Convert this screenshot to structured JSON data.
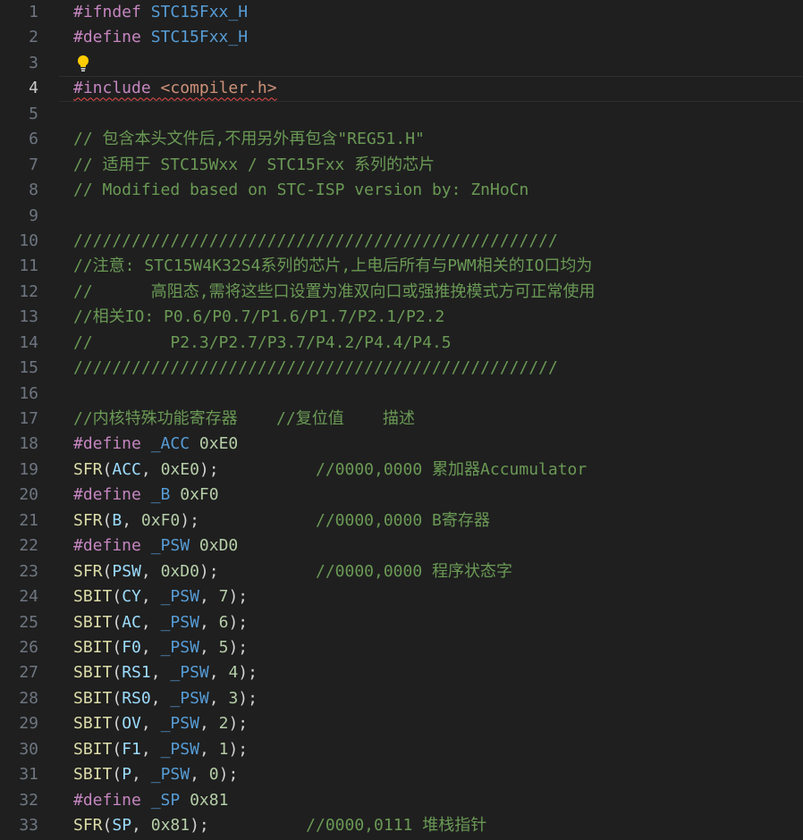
{
  "editor": {
    "lines": [
      {
        "n": "1",
        "tokens": [
          [
            "kw",
            "#ifndef "
          ],
          [
            "mac",
            "STC15Fxx_H"
          ]
        ]
      },
      {
        "n": "2",
        "tokens": [
          [
            "kw",
            "#define "
          ],
          [
            "mac",
            "STC15Fxx_H"
          ]
        ]
      },
      {
        "n": "3",
        "tokens": [],
        "lightbulb": true
      },
      {
        "n": "4",
        "current": true,
        "squiggle": true,
        "tokens": [
          [
            "kw",
            "#include "
          ],
          [
            "str",
            "<compiler.h>"
          ]
        ]
      },
      {
        "n": "5",
        "tokens": []
      },
      {
        "n": "6",
        "tokens": [
          [
            "com",
            "// 包含本头文件后,不用另外再包含\"REG51.H\""
          ]
        ]
      },
      {
        "n": "7",
        "tokens": [
          [
            "com",
            "// 适用于 STC15Wxx / STC15Fxx 系列的芯片"
          ]
        ]
      },
      {
        "n": "8",
        "tokens": [
          [
            "com",
            "// Modified based on STC-ISP version by: ZnHoCn"
          ]
        ]
      },
      {
        "n": "9",
        "tokens": []
      },
      {
        "n": "10",
        "tokens": [
          [
            "com",
            "//////////////////////////////////////////////////"
          ]
        ]
      },
      {
        "n": "11",
        "tokens": [
          [
            "com",
            "//注意: STC15W4K32S4系列的芯片,上电后所有与PWM相关的IO口均为"
          ]
        ]
      },
      {
        "n": "12",
        "tokens": [
          [
            "com",
            "//      高阻态,需将这些口设置为准双向口或强推挽模式方可正常使用"
          ]
        ]
      },
      {
        "n": "13",
        "tokens": [
          [
            "com",
            "//相关IO: P0.6/P0.7/P1.6/P1.7/P2.1/P2.2"
          ]
        ]
      },
      {
        "n": "14",
        "tokens": [
          [
            "com",
            "//        P2.3/P2.7/P3.7/P4.2/P4.4/P4.5"
          ]
        ]
      },
      {
        "n": "15",
        "tokens": [
          [
            "com",
            "//////////////////////////////////////////////////"
          ]
        ]
      },
      {
        "n": "16",
        "tokens": []
      },
      {
        "n": "17",
        "tokens": [
          [
            "com",
            "//内核特殊功能寄存器    //复位值    描述"
          ]
        ]
      },
      {
        "n": "18",
        "tokens": [
          [
            "kw",
            "#define "
          ],
          [
            "mac",
            "_ACC"
          ],
          [
            "plain",
            " "
          ],
          [
            "num",
            "0xE0"
          ]
        ]
      },
      {
        "n": "19",
        "tokens": [
          [
            "fn",
            "SFR"
          ],
          [
            "punc",
            "("
          ],
          [
            "var",
            "ACC"
          ],
          [
            "punc",
            ", "
          ],
          [
            "num",
            "0xE0"
          ],
          [
            "punc",
            ");"
          ],
          [
            "plain",
            "          "
          ],
          [
            "com",
            "//0000,0000 累加器Accumulator"
          ]
        ]
      },
      {
        "n": "20",
        "tokens": [
          [
            "kw",
            "#define "
          ],
          [
            "mac",
            "_B"
          ],
          [
            "plain",
            " "
          ],
          [
            "num",
            "0xF0"
          ]
        ]
      },
      {
        "n": "21",
        "tokens": [
          [
            "fn",
            "SFR"
          ],
          [
            "punc",
            "("
          ],
          [
            "var",
            "B"
          ],
          [
            "punc",
            ", "
          ],
          [
            "num",
            "0xF0"
          ],
          [
            "punc",
            ");"
          ],
          [
            "plain",
            "            "
          ],
          [
            "com",
            "//0000,0000 B寄存器"
          ]
        ]
      },
      {
        "n": "22",
        "tokens": [
          [
            "kw",
            "#define "
          ],
          [
            "mac",
            "_PSW"
          ],
          [
            "plain",
            " "
          ],
          [
            "num",
            "0xD0"
          ]
        ]
      },
      {
        "n": "23",
        "tokens": [
          [
            "fn",
            "SFR"
          ],
          [
            "punc",
            "("
          ],
          [
            "var",
            "PSW"
          ],
          [
            "punc",
            ", "
          ],
          [
            "num",
            "0xD0"
          ],
          [
            "punc",
            ");"
          ],
          [
            "plain",
            "          "
          ],
          [
            "com",
            "//0000,0000 程序状态字"
          ]
        ]
      },
      {
        "n": "24",
        "tokens": [
          [
            "fn",
            "SBIT"
          ],
          [
            "punc",
            "("
          ],
          [
            "var",
            "CY"
          ],
          [
            "punc",
            ", "
          ],
          [
            "mac",
            "_PSW"
          ],
          [
            "punc",
            ", "
          ],
          [
            "num",
            "7"
          ],
          [
            "punc",
            ");"
          ]
        ]
      },
      {
        "n": "25",
        "tokens": [
          [
            "fn",
            "SBIT"
          ],
          [
            "punc",
            "("
          ],
          [
            "var",
            "AC"
          ],
          [
            "punc",
            ", "
          ],
          [
            "mac",
            "_PSW"
          ],
          [
            "punc",
            ", "
          ],
          [
            "num",
            "6"
          ],
          [
            "punc",
            ");"
          ]
        ]
      },
      {
        "n": "26",
        "tokens": [
          [
            "fn",
            "SBIT"
          ],
          [
            "punc",
            "("
          ],
          [
            "var",
            "F0"
          ],
          [
            "punc",
            ", "
          ],
          [
            "mac",
            "_PSW"
          ],
          [
            "punc",
            ", "
          ],
          [
            "num",
            "5"
          ],
          [
            "punc",
            ");"
          ]
        ]
      },
      {
        "n": "27",
        "tokens": [
          [
            "fn",
            "SBIT"
          ],
          [
            "punc",
            "("
          ],
          [
            "var",
            "RS1"
          ],
          [
            "punc",
            ", "
          ],
          [
            "mac",
            "_PSW"
          ],
          [
            "punc",
            ", "
          ],
          [
            "num",
            "4"
          ],
          [
            "punc",
            ");"
          ]
        ]
      },
      {
        "n": "28",
        "tokens": [
          [
            "fn",
            "SBIT"
          ],
          [
            "punc",
            "("
          ],
          [
            "var",
            "RS0"
          ],
          [
            "punc",
            ", "
          ],
          [
            "mac",
            "_PSW"
          ],
          [
            "punc",
            ", "
          ],
          [
            "num",
            "3"
          ],
          [
            "punc",
            ");"
          ]
        ]
      },
      {
        "n": "29",
        "tokens": [
          [
            "fn",
            "SBIT"
          ],
          [
            "punc",
            "("
          ],
          [
            "var",
            "OV"
          ],
          [
            "punc",
            ", "
          ],
          [
            "mac",
            "_PSW"
          ],
          [
            "punc",
            ", "
          ],
          [
            "num",
            "2"
          ],
          [
            "punc",
            ");"
          ]
        ]
      },
      {
        "n": "30",
        "tokens": [
          [
            "fn",
            "SBIT"
          ],
          [
            "punc",
            "("
          ],
          [
            "var",
            "F1"
          ],
          [
            "punc",
            ", "
          ],
          [
            "mac",
            "_PSW"
          ],
          [
            "punc",
            ", "
          ],
          [
            "num",
            "1"
          ],
          [
            "punc",
            ");"
          ]
        ]
      },
      {
        "n": "31",
        "tokens": [
          [
            "fn",
            "SBIT"
          ],
          [
            "punc",
            "("
          ],
          [
            "var",
            "P"
          ],
          [
            "punc",
            ", "
          ],
          [
            "mac",
            "_PSW"
          ],
          [
            "punc",
            ", "
          ],
          [
            "num",
            "0"
          ],
          [
            "punc",
            ");"
          ]
        ]
      },
      {
        "n": "32",
        "tokens": [
          [
            "kw",
            "#define "
          ],
          [
            "mac",
            "_SP"
          ],
          [
            "plain",
            " "
          ],
          [
            "num",
            "0x81"
          ]
        ]
      },
      {
        "n": "33",
        "tokens": [
          [
            "fn",
            "SFR"
          ],
          [
            "punc",
            "("
          ],
          [
            "var",
            "SP"
          ],
          [
            "punc",
            ", "
          ],
          [
            "num",
            "0x81"
          ],
          [
            "punc",
            ");"
          ],
          [
            "plain",
            "          "
          ],
          [
            "com",
            "//0000,0111 堆栈指针"
          ]
        ]
      }
    ]
  },
  "colors": {
    "background": "#1f1f1f",
    "keyword": "#c586c0",
    "macro": "#569cd6",
    "string": "#ce9178",
    "comment": "#6a9955",
    "function": "#dcdcaa",
    "variable": "#9cdcfe",
    "number": "#b5cea8",
    "line_number": "#6e7681",
    "error_squiggle": "#f14c4c",
    "lightbulb": "#ffcc00"
  },
  "icons": {
    "lightbulb": "lightbulb-icon"
  }
}
